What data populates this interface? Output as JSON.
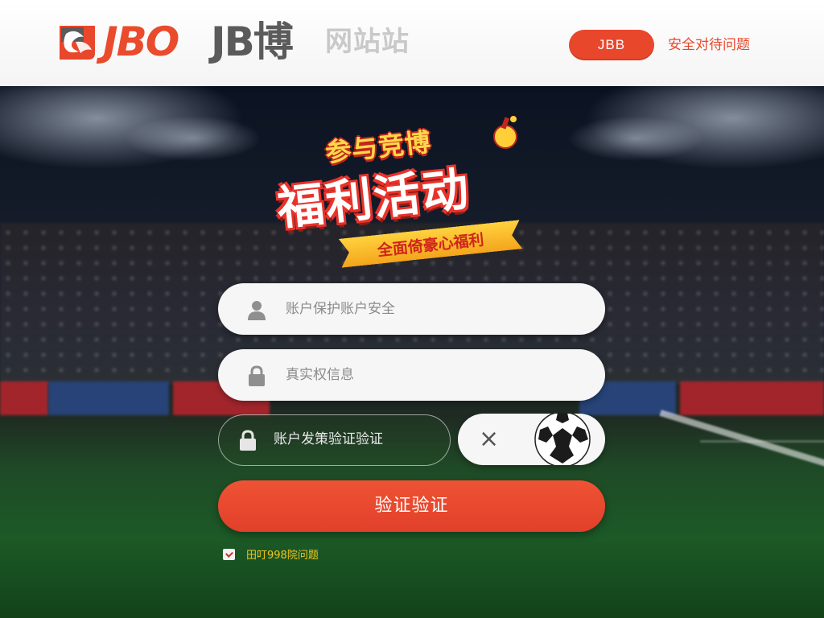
{
  "header": {
    "logo_jbo": "JBO",
    "logo_jb": "JB博",
    "logo_site": "网站站",
    "button_label": "JBB",
    "link_text": "安全对待问题"
  },
  "promo": {
    "top_line": "参与竞博",
    "main_line": "福利活动",
    "ribbon": "全面倚豪心福利"
  },
  "form": {
    "username_placeholder": "账户保护账户安全",
    "password_placeholder": "真实权信息",
    "captcha_placeholder": "账户发策验证验证",
    "captcha_close": "×",
    "submit_label": "验证验证",
    "agree_label": "田叮998院问题"
  },
  "colors": {
    "brand_red": "#e9472c",
    "brand_gray": "#5b5b5b",
    "agree_yellow": "#f2c51c"
  },
  "icons": [
    "logo-icon",
    "user-icon",
    "lock-icon",
    "lock-icon",
    "close-icon",
    "soccer-ball-icon",
    "checkbox-icon"
  ]
}
